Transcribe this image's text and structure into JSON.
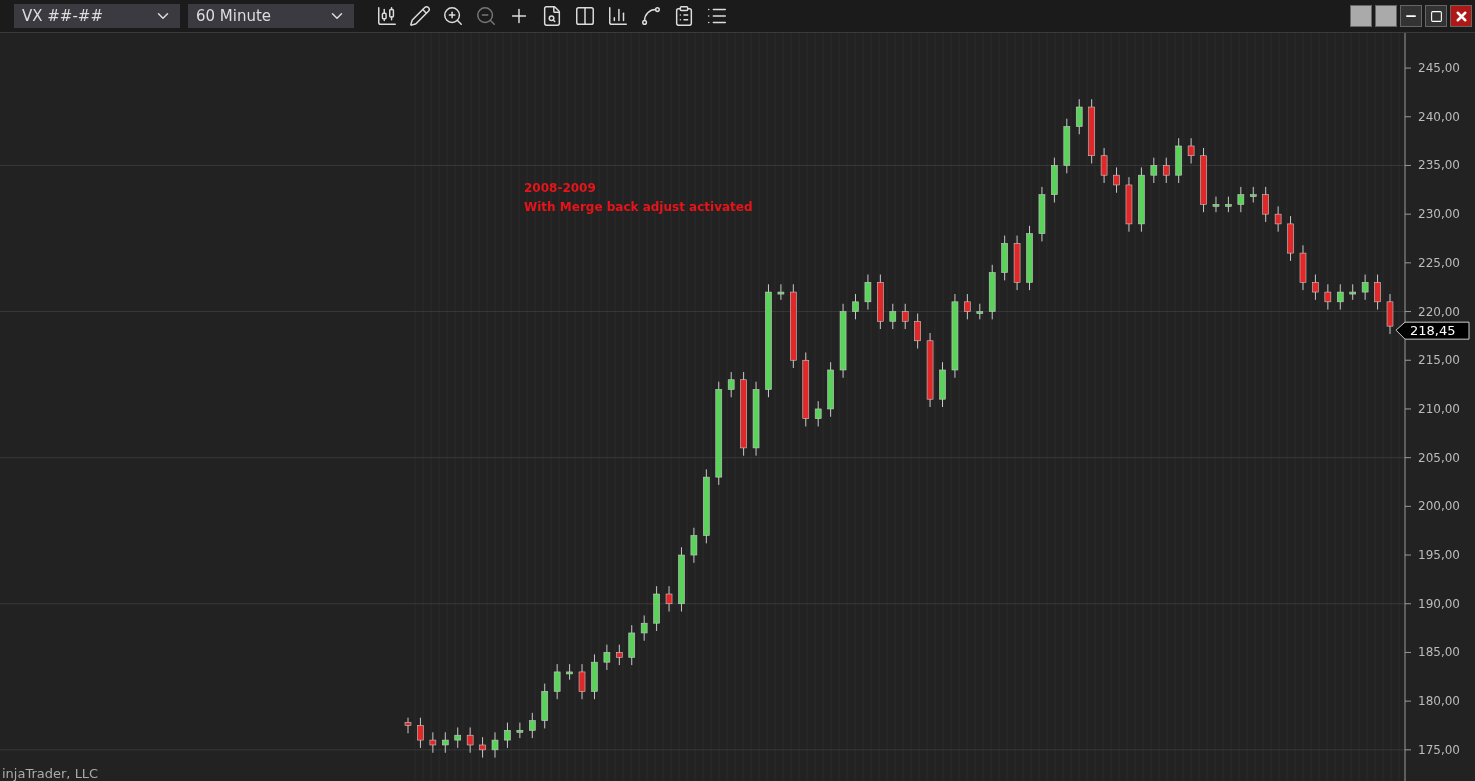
{
  "toolbar": {
    "instrument": "VX ##-##",
    "interval": "60 Minute"
  },
  "chart": {
    "annotation_lines": [
      "2008-2009",
      "With Merge back adjust activated"
    ],
    "last_price": "218,45",
    "footer": "injaTrader, LLC",
    "chart_data": {
      "type": "candlestick",
      "ylim": [
        171.8,
        248.6
      ],
      "grid": true,
      "yticks": [
        {
          "value": 245,
          "label": "245,00"
        },
        {
          "value": 240,
          "label": "240,00"
        },
        {
          "value": 235,
          "label": "235,00"
        },
        {
          "value": 230,
          "label": "230,00"
        },
        {
          "value": 225,
          "label": "225,00"
        },
        {
          "value": 220,
          "label": "220,00"
        },
        {
          "value": 215,
          "label": "215,00"
        },
        {
          "value": 210,
          "label": "210,00"
        },
        {
          "value": 205,
          "label": "205,00"
        },
        {
          "value": 200,
          "label": "200,00"
        },
        {
          "value": 195,
          "label": "195,00"
        },
        {
          "value": 190,
          "label": "190,00"
        },
        {
          "value": 185,
          "label": "185,00"
        },
        {
          "value": 180,
          "label": "180,00"
        },
        {
          "value": 175,
          "label": "175,00"
        }
      ],
      "ohlc": [
        [
          177.8,
          178.3,
          176.7,
          177.5
        ],
        [
          177.5,
          178.3,
          175.2,
          176
        ],
        [
          176,
          176.8,
          174.7,
          175.5
        ],
        [
          175.5,
          176.8,
          174.7,
          176
        ],
        [
          176,
          177.3,
          175.2,
          176.5
        ],
        [
          176.5,
          177.3,
          174.7,
          175.5
        ],
        [
          175.5,
          176.3,
          174.2,
          175
        ],
        [
          175,
          176.8,
          174.2,
          176
        ],
        [
          176,
          177.8,
          175.2,
          177
        ],
        [
          177,
          177.8,
          176.2,
          177
        ],
        [
          177,
          178.8,
          176.2,
          178
        ],
        [
          178,
          181.8,
          177.2,
          181
        ],
        [
          181,
          183.8,
          180.2,
          183
        ],
        [
          183,
          183.8,
          182.2,
          183
        ],
        [
          183,
          183.8,
          180.2,
          181
        ],
        [
          181,
          184.8,
          180.2,
          184
        ],
        [
          184,
          185.8,
          183.2,
          185
        ],
        [
          185,
          185.8,
          183.7,
          184.5
        ],
        [
          184.5,
          187.8,
          183.7,
          187
        ],
        [
          187,
          188.8,
          186.2,
          188
        ],
        [
          188,
          191.8,
          187.2,
          191
        ],
        [
          191,
          191.8,
          189.2,
          190
        ],
        [
          190,
          195.8,
          189.2,
          195
        ],
        [
          195,
          197.8,
          194.2,
          197
        ],
        [
          197,
          203.8,
          196.2,
          203
        ],
        [
          203,
          212.8,
          202.2,
          212
        ],
        [
          212,
          213.8,
          211.2,
          213
        ],
        [
          213,
          213.8,
          205.2,
          206
        ],
        [
          206,
          212.8,
          205.2,
          212
        ],
        [
          212,
          222.8,
          211.2,
          222
        ],
        [
          222,
          222.8,
          221.2,
          222
        ],
        [
          222,
          222.8,
          214.2,
          215
        ],
        [
          215,
          215.8,
          208.2,
          209
        ],
        [
          209,
          210.8,
          208.2,
          210
        ],
        [
          210,
          214.8,
          209.2,
          214
        ],
        [
          214,
          220.8,
          213.2,
          220
        ],
        [
          220,
          221.8,
          219.2,
          221
        ],
        [
          221,
          223.8,
          220.2,
          223
        ],
        [
          223,
          223.8,
          218.2,
          219
        ],
        [
          219,
          220.8,
          218.2,
          220
        ],
        [
          220,
          220.8,
          218.2,
          219
        ],
        [
          219,
          219.8,
          216.2,
          217
        ],
        [
          217,
          217.8,
          210.2,
          211
        ],
        [
          211,
          214.8,
          210.2,
          214
        ],
        [
          214,
          221.8,
          213.2,
          221
        ],
        [
          221,
          221.8,
          219.2,
          220
        ],
        [
          220,
          220.8,
          219.2,
          220
        ],
        [
          220,
          224.8,
          219.2,
          224
        ],
        [
          224,
          227.8,
          223.2,
          227
        ],
        [
          227,
          227.8,
          222.2,
          223
        ],
        [
          223,
          228.8,
          222.2,
          228
        ],
        [
          228,
          232.8,
          227.2,
          232
        ],
        [
          232,
          235.8,
          231.2,
          235
        ],
        [
          235,
          239.8,
          234.2,
          239
        ],
        [
          239,
          241.8,
          238.2,
          241
        ],
        [
          241,
          241.8,
          235.2,
          236
        ],
        [
          236,
          236.8,
          233.2,
          234
        ],
        [
          234,
          234.8,
          232.2,
          233
        ],
        [
          233,
          233.8,
          228.2,
          229
        ],
        [
          229,
          234.8,
          228.2,
          234
        ],
        [
          234,
          235.8,
          233.2,
          235
        ],
        [
          235,
          235.8,
          233.2,
          234
        ],
        [
          234,
          237.8,
          233.2,
          237
        ],
        [
          237,
          237.8,
          235.2,
          236
        ],
        [
          236,
          236.8,
          230.2,
          231
        ],
        [
          231,
          231.8,
          230.2,
          231
        ],
        [
          231,
          231.8,
          230.2,
          231
        ],
        [
          231,
          232.8,
          230.2,
          232
        ],
        [
          232,
          232.8,
          231.2,
          232
        ],
        [
          232,
          232.8,
          229.2,
          230
        ],
        [
          230,
          230.8,
          228.2,
          229
        ],
        [
          229,
          229.8,
          225.2,
          226
        ],
        [
          226,
          226.8,
          222.2,
          223
        ],
        [
          223,
          223.8,
          221.2,
          222
        ],
        [
          222,
          222.8,
          220.2,
          221
        ],
        [
          221,
          222.8,
          220.2,
          222
        ],
        [
          222,
          222.8,
          221.2,
          222
        ],
        [
          222,
          223.8,
          221.2,
          223
        ],
        [
          223,
          223.8,
          220.2,
          221
        ],
        [
          221,
          221.8,
          217.7,
          218.5
        ]
      ]
    }
  }
}
